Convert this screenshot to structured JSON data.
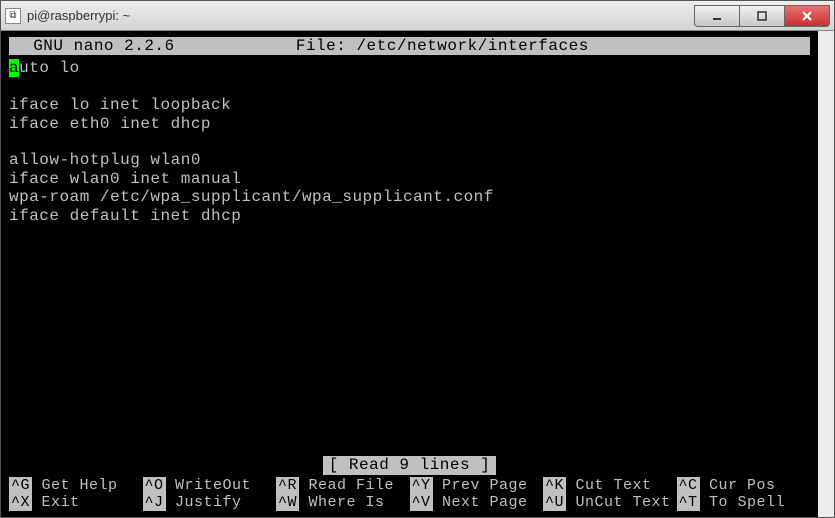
{
  "window": {
    "title": "pi@raspberrypi: ~",
    "icon_glyph": "⧉"
  },
  "nano": {
    "version": "GNU nano 2.2.6",
    "file_label": "File: /etc/network/interfaces"
  },
  "editor": {
    "cursor_char": "a",
    "line1_rest": "uto lo",
    "line2": "",
    "line3": "iface lo inet loopback",
    "line4": "iface eth0 inet dhcp",
    "line5": "",
    "line6": "allow-hotplug wlan0",
    "line7": "iface wlan0 inet manual",
    "line8": "wpa-roam /etc/wpa_supplicant/wpa_supplicant.conf",
    "line9": "iface default inet dhcp"
  },
  "status": "[ Read 9 lines ]",
  "shortcuts": {
    "r1": [
      {
        "key": "^G",
        "label": " Get Help"
      },
      {
        "key": "^O",
        "label": " WriteOut"
      },
      {
        "key": "^R",
        "label": " Read File"
      },
      {
        "key": "^Y",
        "label": " Prev Page"
      },
      {
        "key": "^K",
        "label": " Cut Text"
      },
      {
        "key": "^C",
        "label": " Cur Pos"
      }
    ],
    "r2": [
      {
        "key": "^X",
        "label": " Exit"
      },
      {
        "key": "^J",
        "label": " Justify"
      },
      {
        "key": "^W",
        "label": " Where Is"
      },
      {
        "key": "^V",
        "label": " Next Page"
      },
      {
        "key": "^U",
        "label": " UnCut Text"
      },
      {
        "key": "^T",
        "label": " To Spell"
      }
    ]
  }
}
